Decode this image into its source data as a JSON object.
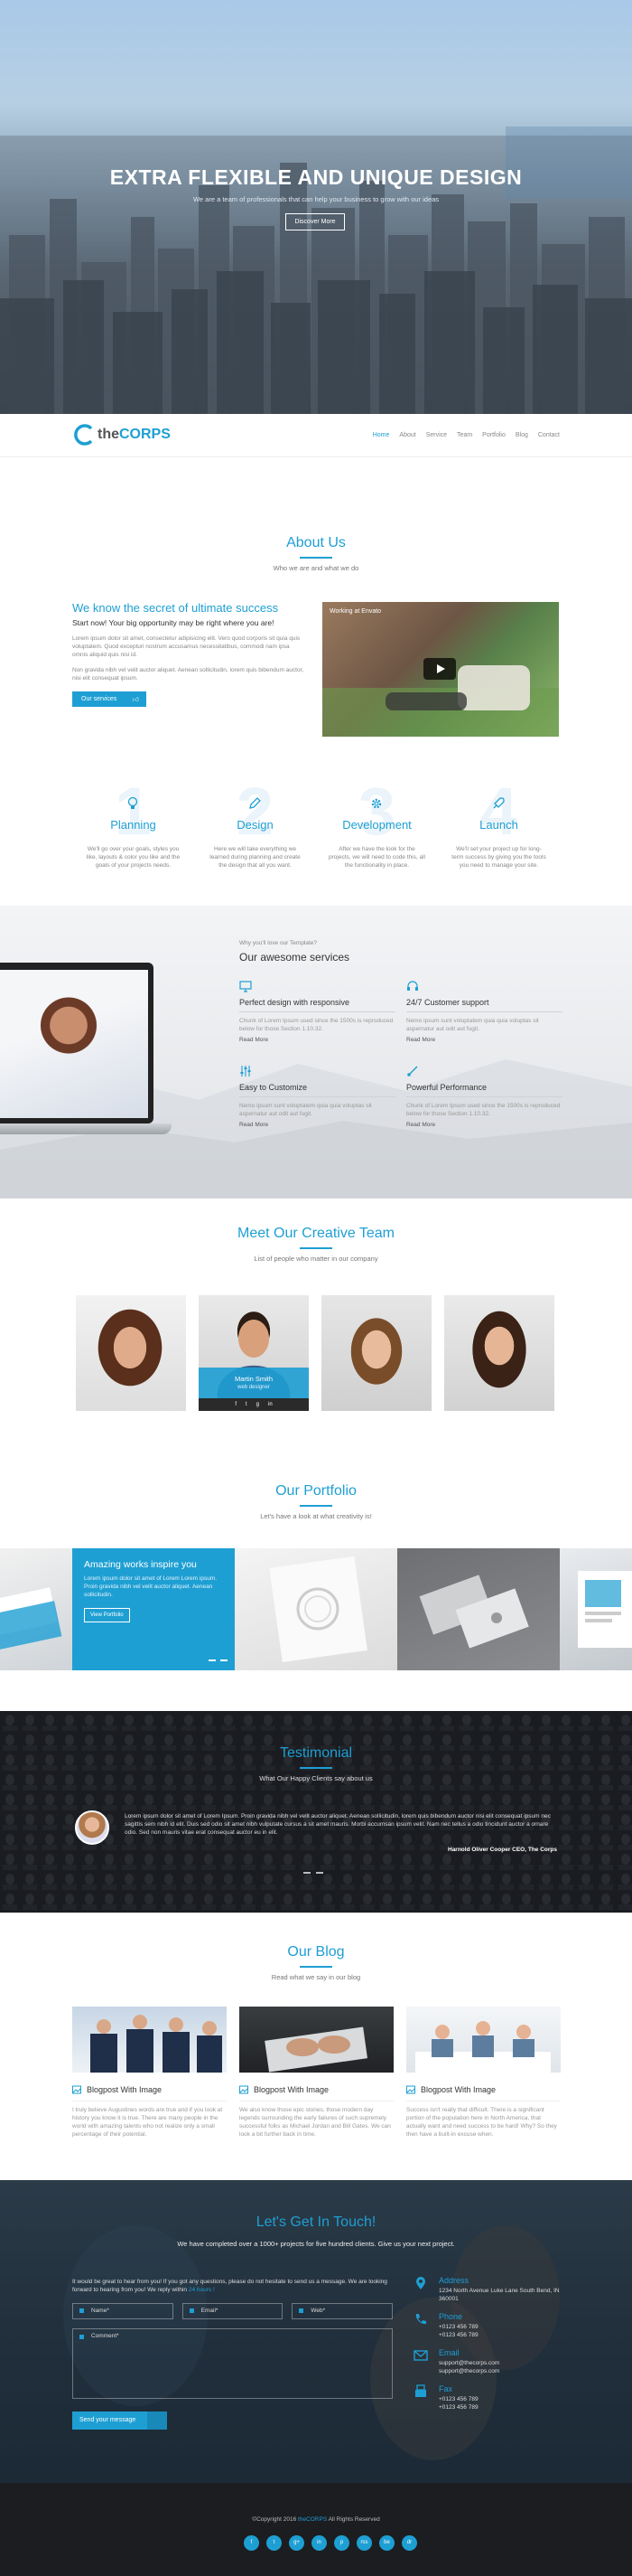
{
  "hero": {
    "title": "EXTRA FLEXIBLE AND UNIQUE DESIGN",
    "subtitle": "We are a team of professionals that can help your business to grow with our ideas",
    "button": "Discover More"
  },
  "nav": {
    "logo_the": "the",
    "logo_corps": "CORPS",
    "items": [
      "Home",
      "About",
      "Service",
      "Team",
      "Portfolio",
      "Blog",
      "Contact"
    ]
  },
  "about": {
    "title": "About Us",
    "subtitle": "Who we are and what we do",
    "heading": "We know the secret of ultimate success",
    "tagline": "Start now! Your big opportunity may be right where you are!",
    "para1": "Lorem ipsum dolor sit amet, consectetur adipisicing elit. Vero quod corporis sit quia quis voluptatem. Quod excepturi nostrum accusamus necessitatibus, commodi nam ipsa omnis aliquid quis nisi id.",
    "para2": "Non gravida nibh vel velit auctor aliquet. Aenean sollicitudin, lorem quis bibendum auctor, nisi elit consequat ipsum.",
    "button": "Our services",
    "video_title": "Working at Envato",
    "features": [
      {
        "num": "1",
        "title": "Planning",
        "text": "We'll go over your goals, styles you like, layouts & color you like and the goals of your projects needs."
      },
      {
        "num": "2",
        "title": "Design",
        "text": "Here we will take everything we learned during planning and create the design that all you want."
      },
      {
        "num": "3",
        "title": "Development",
        "text": "After we have the look for the projects, we will need to code this, all the functionality in place."
      },
      {
        "num": "4",
        "title": "Launch",
        "text": "We'll set your project up for long-term success by giving you the tools you need to manage your site."
      }
    ]
  },
  "services": {
    "kicker": "Why you'll love our Template?",
    "title": "Our awesome services",
    "items": [
      {
        "title": "Perfect design with responsive",
        "text": "Chunk of Lorem Ipsum used since the 1500s is reproduced below for those Section 1.10.32.",
        "more": "Read More"
      },
      {
        "title": "24/7 Customer support",
        "text": "Nemo ipsum sunt voluptatem quia quia voluptas sit aspernatur aut odit aut fugit.",
        "more": "Read More"
      },
      {
        "title": "Easy to Customize",
        "text": "Nemo ipsum sunt voluptatem quia quia voluptas sit aspernatur aut odit aut fugit.",
        "more": "Read More"
      },
      {
        "title": "Powerful Performance",
        "text": "Chunk of Lorem Ipsum used since the 1500s is reproduced below for those Section 1.10.32.",
        "more": "Read More"
      }
    ]
  },
  "team": {
    "title": "Meet Our Creative Team",
    "subtitle": "List of people who matter in our company",
    "featured": {
      "name": "Martin Smith",
      "role": "web designer",
      "social": [
        "f",
        "t",
        "g",
        "in"
      ]
    }
  },
  "portfolio": {
    "title": "Our Portfolio",
    "subtitle": "Let's have a look at what creativity is!",
    "card_title": "Amazing works inspire you",
    "card_text": "Lorem ipsum dolor sit amet of Lorem Lorem ipsum. Proin gravida nibh vel velit auctor aliquet. Aenean sollicitudin.",
    "card_button": "View Portfolio"
  },
  "testimonial": {
    "title": "Testimonial",
    "subtitle": "What Our Happy Clients say about us",
    "text": "Lorem ipsum dolor sit amet of Lorem Ipsum. Proin gravida nibh vel velit auctor aliquet. Aenean sollicitudin, lorem quis bibendum auctor nisi elit consequat ipsum nec sagittis sem nibh id elit. Duis sed odio sit amet nibh vulputate cursus a sit amet mauris. Morbi accumsan ipsum velit. Nam nec tellus a odio tincidunt auctor a ornare odio. Sed non mauris vitae erat consequat auctor eu in elit.",
    "author": "Harnold Oliver Cooper CEO, The Corps"
  },
  "blog": {
    "title": "Our Blog",
    "subtitle": "Read what we say in our blog",
    "posts": [
      {
        "title": "Blogpost With Image",
        "text": "I truly believe Augustines words are true and if you look at history you know it is true. There are many people in the world with amazing talents who not realize only a small percentage of their potential."
      },
      {
        "title": "Blogpost With Image",
        "text": "We also know those epic stories, those modern day legends surrounding the early failures of such supremely successful folks as Michael Jordan and Bill Gates. We can look a bit further back in time."
      },
      {
        "title": "Blogpost With Image",
        "text": "Success isn't really that difficult. There is a significant portion of the population here in North America, that actually want and need success to be hard! Why? So they then have a built-in excuse when."
      }
    ]
  },
  "contact": {
    "title": "Let's Get In Touch!",
    "subtitle": "We have completed over a 1000+ projects for five hundred clients. Give us your next project.",
    "intro": "It would be great to hear from you! If you got any questions, please do not hesitate to send us a message. We are looking forward to hearing from you! We reply within",
    "intro_link": "24 hours !",
    "name_ph": "Name*",
    "email_ph": "Email*",
    "web_ph": "Web*",
    "comment_ph": "Comment*",
    "send": "Send your message",
    "info": [
      {
        "label": "Address",
        "value": "1234 North Avenue Luke Lane South Bend, IN 360001"
      },
      {
        "label": "Phone",
        "value": "+0123 456 789\n+0123 456 789"
      },
      {
        "label": "Email",
        "value": "support@thecorps.com\nsupport@thecorps.com"
      },
      {
        "label": "Fax",
        "value": "+0123 456 789\n+0123 456 789"
      }
    ]
  },
  "footer": {
    "copy_pre": "©Copyright 2016",
    "copy_brand": "theCORPS",
    "copy_post": "All Rights Reserved",
    "socials": [
      "f",
      "t",
      "g+",
      "in",
      "p",
      "rss",
      "be",
      "dr"
    ]
  },
  "colors": {
    "accent": "#1e9fd3",
    "dark": "#1c1d20"
  }
}
